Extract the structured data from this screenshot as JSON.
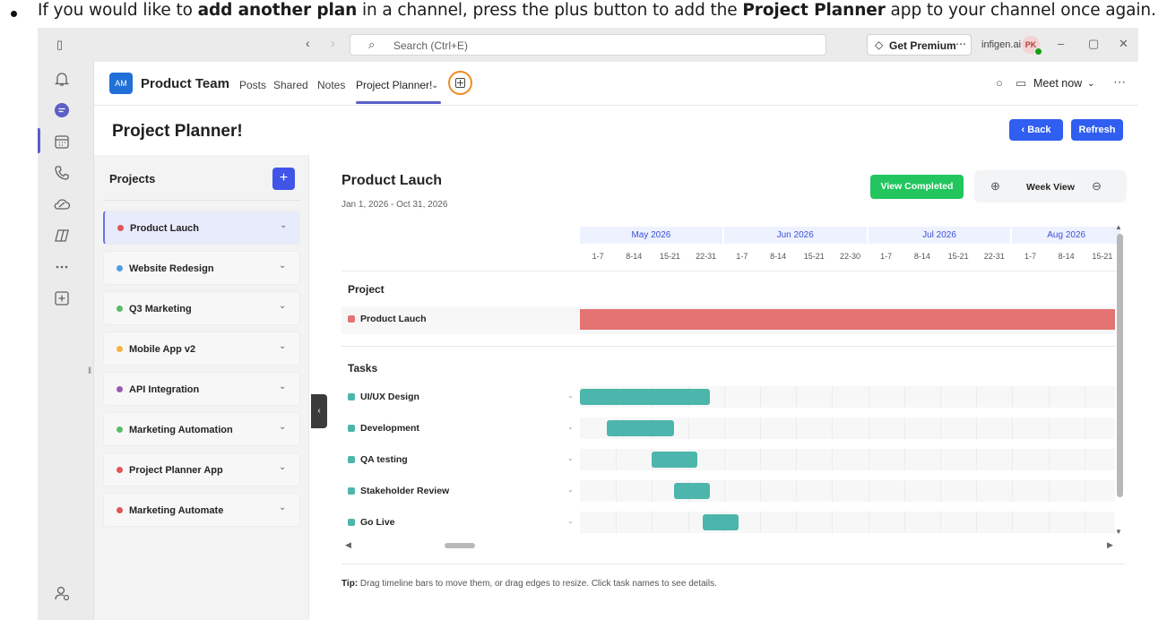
{
  "doc": {
    "pre": "If you would like to ",
    "bold1": "add another plan",
    "mid": " in a channel, press the plus button to add the ",
    "bold2": "Project Planner",
    "post": " app to your channel once again."
  },
  "titlebar": {
    "search_placeholder": "Search (Ctrl+E)",
    "premium_label": "Get Premium",
    "org": "infigen.ai",
    "avatar_initials": "PK"
  },
  "channel": {
    "team_avatar": "AM",
    "team_name": "Product Team",
    "tabs": [
      "Posts",
      "Shared",
      "Notes",
      "Project Planner!"
    ],
    "meet_label": "Meet now"
  },
  "page": {
    "title": "Project Planner!",
    "back_label": "Back",
    "refresh_label": "Refresh"
  },
  "sidebar": {
    "title": "Projects",
    "add_label": "+",
    "projects": [
      {
        "name": "Product Lauch",
        "color": "#e05555"
      },
      {
        "name": "Website Redesign",
        "color": "#4d9de0"
      },
      {
        "name": "Q3 Marketing",
        "color": "#5cba6b"
      },
      {
        "name": "Mobile App v2",
        "color": "#f3b33d"
      },
      {
        "name": "API Integration",
        "color": "#9b59b6"
      },
      {
        "name": "Marketing Automation",
        "color": "#5cba6b"
      },
      {
        "name": "Project Planner App",
        "color": "#e05555"
      },
      {
        "name": "Marketing Automate",
        "color": "#e05555"
      }
    ]
  },
  "gantt": {
    "title": "Product Lauch",
    "range": "Jan 1, 2026 - Oct 31, 2026",
    "completed_label": "View Completed",
    "zoom_label": "Week View",
    "months": [
      "May 2026",
      "Jun 2026",
      "Jul 2026",
      "Aug 2026"
    ],
    "weeks": [
      "1-7",
      "8-14",
      "15-21",
      "22-31",
      "1-7",
      "8-14",
      "15-21",
      "22-30",
      "1-7",
      "8-14",
      "15-21",
      "22-31",
      "1-7",
      "8-14",
      "15-21"
    ],
    "section_project": "Project",
    "project_row": {
      "name": "Product Lauch",
      "color": "#e57373"
    },
    "section_tasks": "Tasks",
    "tasks": [
      {
        "name": "UI/UX Design",
        "start_week": 0,
        "end_week": 3.6
      },
      {
        "name": "Development",
        "start_week": 0.75,
        "end_week": 2.6
      },
      {
        "name": "QA testing",
        "start_week": 2.0,
        "end_week": 3.25
      },
      {
        "name": "Stakeholder Review",
        "start_week": 2.6,
        "end_week": 3.6
      },
      {
        "name": "Go Live",
        "start_week": 3.4,
        "end_week": 4.4
      }
    ],
    "task_color": "#4db6ac",
    "tip_label": "Tip:",
    "tip_text": " Drag timeline bars to move them, or drag edges to resize. Click task names to see details."
  }
}
